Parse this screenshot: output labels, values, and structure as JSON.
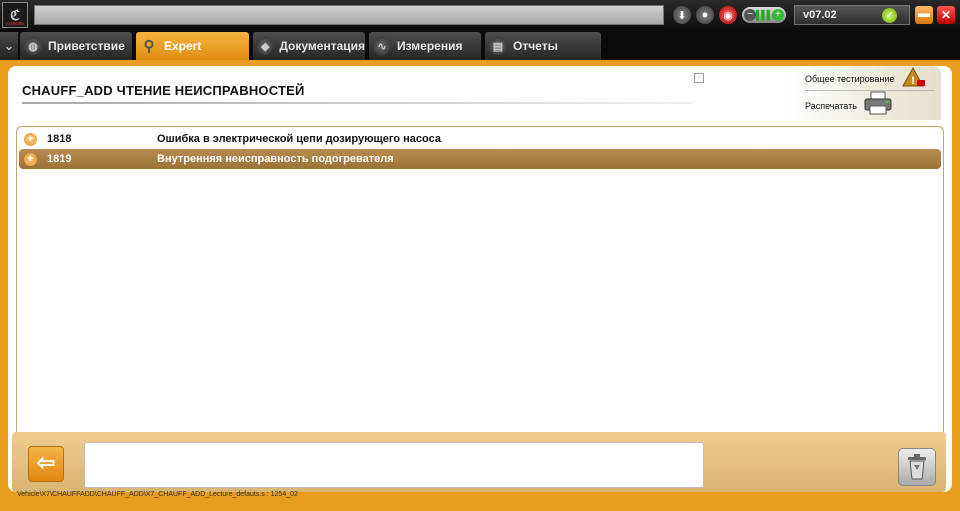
{
  "topbar": {
    "logo_text": "ℭ",
    "logo_caption": "CITROËN",
    "path_value": "",
    "version": "v07.02"
  },
  "tabs": [
    {
      "label": "Приветствие",
      "icon": "globe-icon"
    },
    {
      "label": "Expert",
      "icon": "magnifier-icon"
    },
    {
      "label": "Документация",
      "icon": "book-icon"
    },
    {
      "label": "Измерения",
      "icon": "waveform-icon"
    },
    {
      "label": "Отчеты",
      "icon": "document-icon"
    }
  ],
  "active_tab": "Expert",
  "page": {
    "title": "CHAUFF_ADD  ЧТЕНИЕ НЕИСПРАВНОСТЕЙ",
    "marker": "·"
  },
  "actions": {
    "global_test_label": "Общее тестирование",
    "print_label": "Распечатать"
  },
  "faults": [
    {
      "code": "1818",
      "description": "Ошибка в электрической цепи дозирующего насоса",
      "selected": false
    },
    {
      "code": "1819",
      "description": "Внутренняя неисправность подогревателя",
      "selected": true
    }
  ],
  "bottom": {
    "back_icon": "arrow-left-icon",
    "message": "",
    "trash_icon": "trash-icon",
    "status_path": "Vehicle\\X7\\CHAUFFADD\\CHAUFF_ADD\\X7_CHAUFF_ADD_Lecture_defauts.s : 1254_02"
  },
  "colors": {
    "accent": "#e79d1d",
    "selected_row": "#a67a41",
    "tab_active": "#f0a52c"
  }
}
